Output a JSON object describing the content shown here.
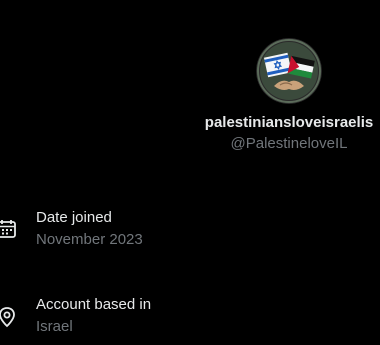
{
  "profile": {
    "display_name": "palestiniansloveisraelis",
    "handle": "@PalestineloveIL",
    "avatar_icon": "flags-handshake-avatar"
  },
  "details": [
    {
      "icon": "calendar-icon",
      "label": "Date joined",
      "value": "November 2023"
    },
    {
      "icon": "location-pin-icon",
      "label": "Account based in",
      "value": "Israel"
    }
  ],
  "colors": {
    "background": "#000000",
    "primary_text": "#e7e9ea",
    "secondary_text": "#71767b"
  }
}
